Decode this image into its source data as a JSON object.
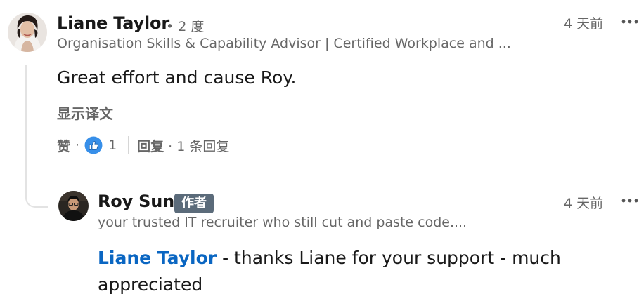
{
  "comment": {
    "author_name": "Liane Taylor",
    "degree": "• 2 度",
    "headline": "Organisation Skills & Capability Advisor | Certified Workplace and ...",
    "timestamp": "4 天前",
    "more_label": "•••",
    "text": "Great effort and cause Roy.",
    "translate_label": "显示译文",
    "actions": {
      "like_label": "赞",
      "separator": "·",
      "reaction_icon": "thumbs-up-icon",
      "like_count": "1",
      "reply_label": "回复",
      "reply_count": "· 1 条回复"
    }
  },
  "reply": {
    "author_name": "Roy Sun",
    "author_badge": "作者",
    "headline": "your trusted IT recruiter who still cut and paste code....",
    "timestamp": "4 天前",
    "more_label": "•••",
    "mention": "Liane Taylor",
    "text": " - thanks Liane for your support - much appreciated"
  },
  "colors": {
    "link": "#0a66c2",
    "badge_bg": "#5b6b7a",
    "like_blue": "#378fe9"
  }
}
